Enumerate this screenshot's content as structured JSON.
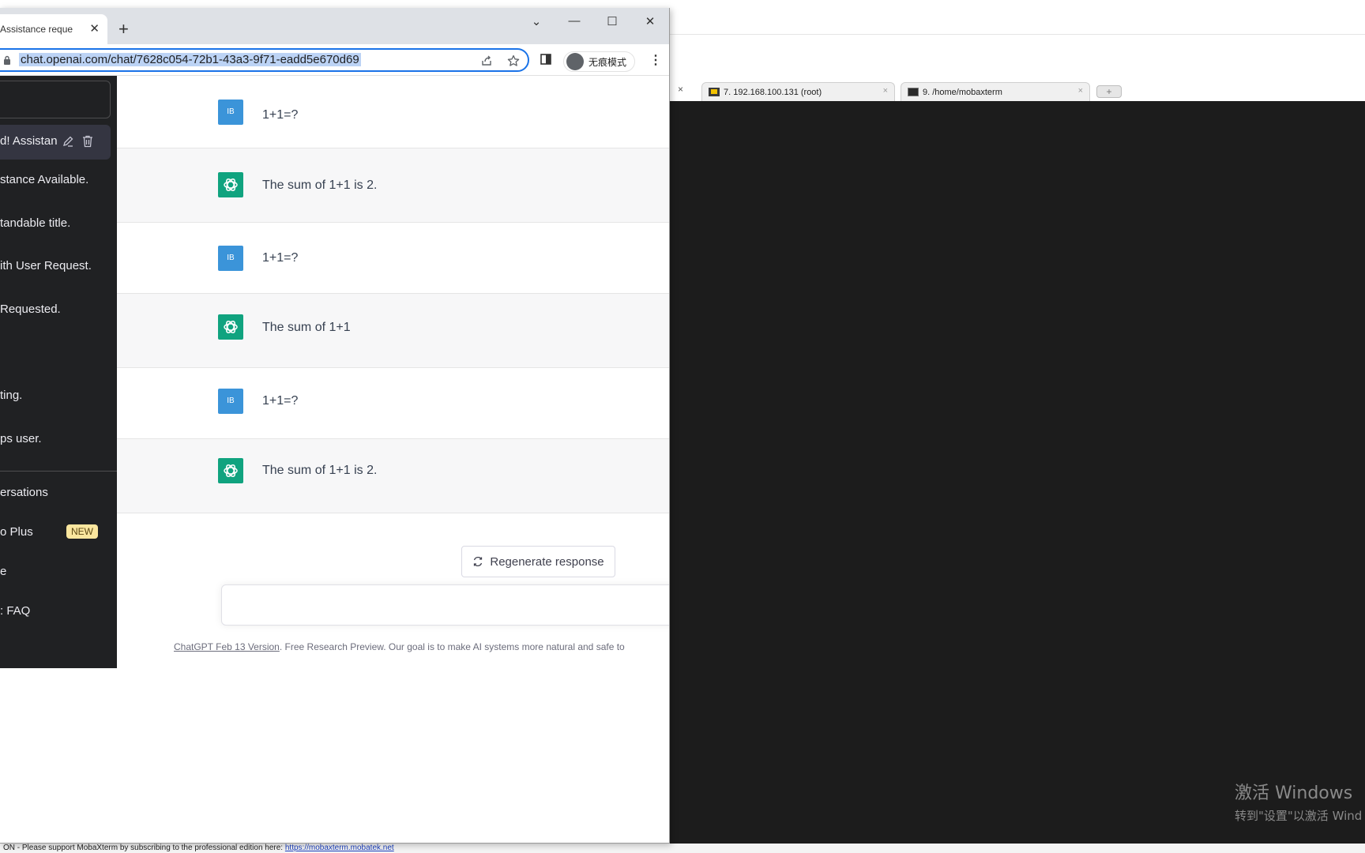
{
  "moba": {
    "tabs": [
      {
        "label": "7. 192.168.100.131 (root)"
      },
      {
        "label": "9. /home/mobaxterm"
      }
    ],
    "close_glyph": "×",
    "new_tab_glyph": "+",
    "activate_title": "激活 Windows",
    "activate_sub": "转到\"设置\"以激活 Wind",
    "status_text": "ON - Please support MobaXterm by subscribing to the professional edition here: ",
    "status_link": "https://mobaxterm.mobatek.net"
  },
  "browser": {
    "tab_title": "Assistance reque",
    "tab_close": "✕",
    "new_tab": "+",
    "url": "chat.openai.com/chat/7628c054-72b1-43a3-9f71-eadd5e670d69",
    "incognito_label": "无痕模式",
    "menu_glyph": "⋮",
    "window_controls": {
      "dropdown": "⌄",
      "minimize": "—",
      "maximize": "☐",
      "close": "✕"
    }
  },
  "sidebar": {
    "active_conversation": "d! Assistanc",
    "conversations": [
      "stance Available.",
      "tandable title.",
      "ith User Request.",
      " Requested.",
      "ting.",
      "ps user."
    ],
    "links": {
      "clear": "ersations",
      "upgrade": "o Plus",
      "new_badge": "NEW",
      "mode": "e",
      "faq": ": FAQ"
    }
  },
  "thread": {
    "messages": [
      {
        "role": "user",
        "avatar": "IB",
        "text": "1+1=?"
      },
      {
        "role": "assistant",
        "text": "The sum of 1+1 is 2."
      },
      {
        "role": "user",
        "avatar": "IB",
        "text": "1+1=?"
      },
      {
        "role": "assistant",
        "text": "The sum of 1+1"
      },
      {
        "role": "user",
        "avatar": "IB",
        "text": "1+1=?"
      },
      {
        "role": "assistant",
        "text": "The sum of 1+1 is 2."
      }
    ],
    "regenerate_label": "Regenerate response",
    "footer_version": "ChatGPT Feb 13 Version",
    "footer_text": ". Free Research Preview. Our goal is to make AI systems more natural and safe to"
  },
  "colors": {
    "chatgpt_green": "#10a37f",
    "user_avatar": "#3b94d9",
    "sidebar_bg": "#202123",
    "terminal_bg": "#1c1c1c",
    "omnibox_focus": "#1a73e8"
  }
}
